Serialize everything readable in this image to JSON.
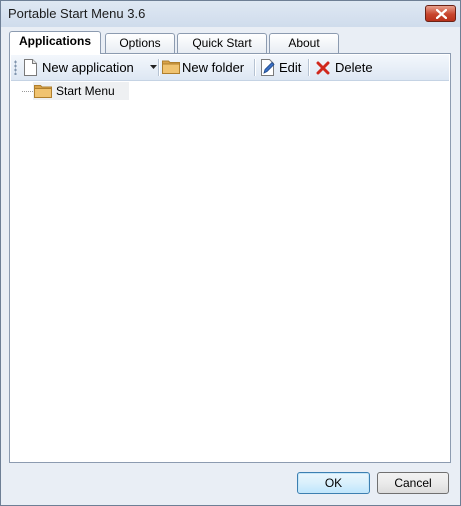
{
  "window": {
    "title": "Portable Start Menu 3.6"
  },
  "tabs": [
    {
      "label": "Applications",
      "active": true
    },
    {
      "label": "Options",
      "active": false
    },
    {
      "label": "Quick Start",
      "active": false
    },
    {
      "label": "About",
      "active": false
    }
  ],
  "toolbar": {
    "new_application": "New application",
    "new_folder": "New folder",
    "edit": "Edit",
    "delete": "Delete"
  },
  "tree": {
    "root_label": "Start Menu"
  },
  "footer": {
    "ok": "OK",
    "cancel": "Cancel"
  },
  "colors": {
    "folder": "#e8b55a",
    "delete_red": "#d0281c",
    "accent": "#3c7fb1"
  },
  "icons": {
    "close": "close-icon",
    "new_application": "document-icon",
    "dropdown": "chevron-down-icon",
    "new_folder": "folder-icon",
    "edit": "pencil-icon",
    "delete": "red-x-icon",
    "tree_root": "folder-icon"
  }
}
